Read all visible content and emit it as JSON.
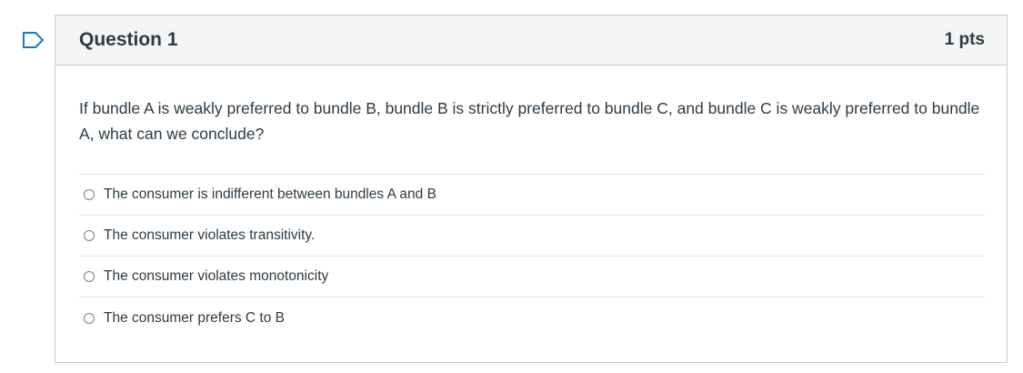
{
  "flag": {
    "icon": "bookmark-flag-icon",
    "color": "#1a7abf"
  },
  "question": {
    "title": "Question 1",
    "points": "1 pts",
    "text": "If bundle A is weakly preferred to bundle B, bundle B is strictly preferred to bundle C, and bundle C is weakly preferred to bundle A, what can we conclude?",
    "answers": [
      {
        "label": "The consumer is indifferent between bundles A and B",
        "selected": false
      },
      {
        "label": "The consumer violates transitivity.",
        "selected": false
      },
      {
        "label": "The consumer violates monotonicity",
        "selected": false
      },
      {
        "label": "The consumer prefers C to B",
        "selected": false
      }
    ]
  },
  "colors": {
    "header_bg": "#f5f5f5",
    "border": "#c7cdd1",
    "text": "#2d3b45",
    "divider": "#e3e6e8"
  }
}
